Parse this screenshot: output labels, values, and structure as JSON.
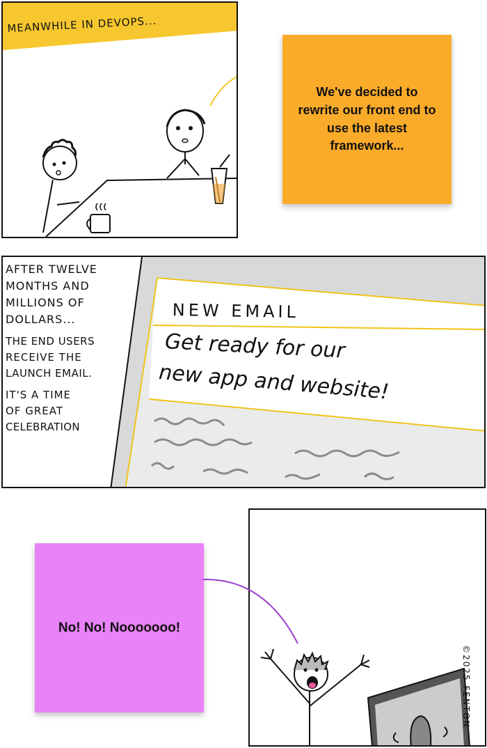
{
  "panel1": {
    "caption": "MEANWHILE IN DEVOPS...",
    "caption_color": "#f7c72f",
    "note_text": "We've decided to rewrite our front end to use the latest framework...",
    "note_color": "#fbab2a"
  },
  "panel2": {
    "narration": [
      "AFTER TWELVE",
      "MONTHS AND",
      "MILLIONS OF",
      "DOLLARS...",
      "THE END USERS",
      "RECEIVE THE",
      "LAUNCH EMAIL.",
      "IT'S A TIME",
      "OF GREAT",
      "CELEBRATION"
    ],
    "email_title": "NEW EMAIL",
    "email_body_line1": "Get ready for our",
    "email_body_line2": "new app and website!",
    "accent_color": "#f0c419"
  },
  "panel3": {
    "note_text": "No! No! Nooooooo!",
    "note_color": "#e882f7",
    "signature": "©2025 FENTON"
  }
}
